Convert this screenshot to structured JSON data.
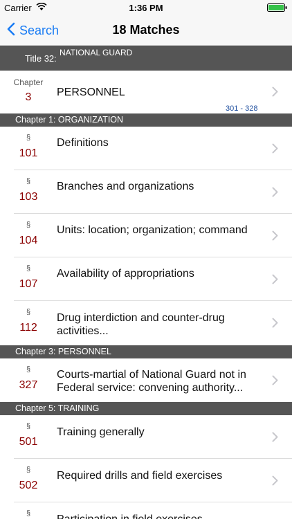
{
  "status_bar": {
    "carrier": "Carrier",
    "time": "1:36 PM"
  },
  "nav": {
    "back_label": "Search",
    "title": "18 Matches"
  },
  "title_header": {
    "label": "Title 32:",
    "name": "NATIONAL GUARD"
  },
  "chapter_row": {
    "kind": "Chapter",
    "number": "3",
    "name": "PERSONNEL",
    "range": "301 - 328"
  },
  "sections": [
    {
      "header": "Chapter 1: ORGANIZATION",
      "items": [
        {
          "symbol": "§",
          "number": "101",
          "label": "Definitions"
        },
        {
          "symbol": "§",
          "number": "103",
          "label": "Branches and organizations"
        },
        {
          "symbol": "§",
          "number": "104",
          "label": "Units: location; organization; command"
        },
        {
          "symbol": "§",
          "number": "107",
          "label": "Availability of appropriations"
        },
        {
          "symbol": "§",
          "number": "112",
          "label": "Drug interdiction and counter-drug activities..."
        }
      ]
    },
    {
      "header": "Chapter 3: PERSONNEL",
      "items": [
        {
          "symbol": "§",
          "number": "327",
          "label": "Courts-martial of National Guard not in Federal service: convening authority..."
        }
      ]
    },
    {
      "header": "Chapter 5: TRAINING",
      "items": [
        {
          "symbol": "§",
          "number": "501",
          "label": "Training generally"
        },
        {
          "symbol": "§",
          "number": "502",
          "label": "Required drills and field exercises"
        },
        {
          "symbol": "§",
          "number": "",
          "label": "Participation in field exercises"
        }
      ]
    }
  ],
  "colors": {
    "accent": "#1a7cf4",
    "section_number": "#8b0000",
    "header_bg": "#555555"
  }
}
